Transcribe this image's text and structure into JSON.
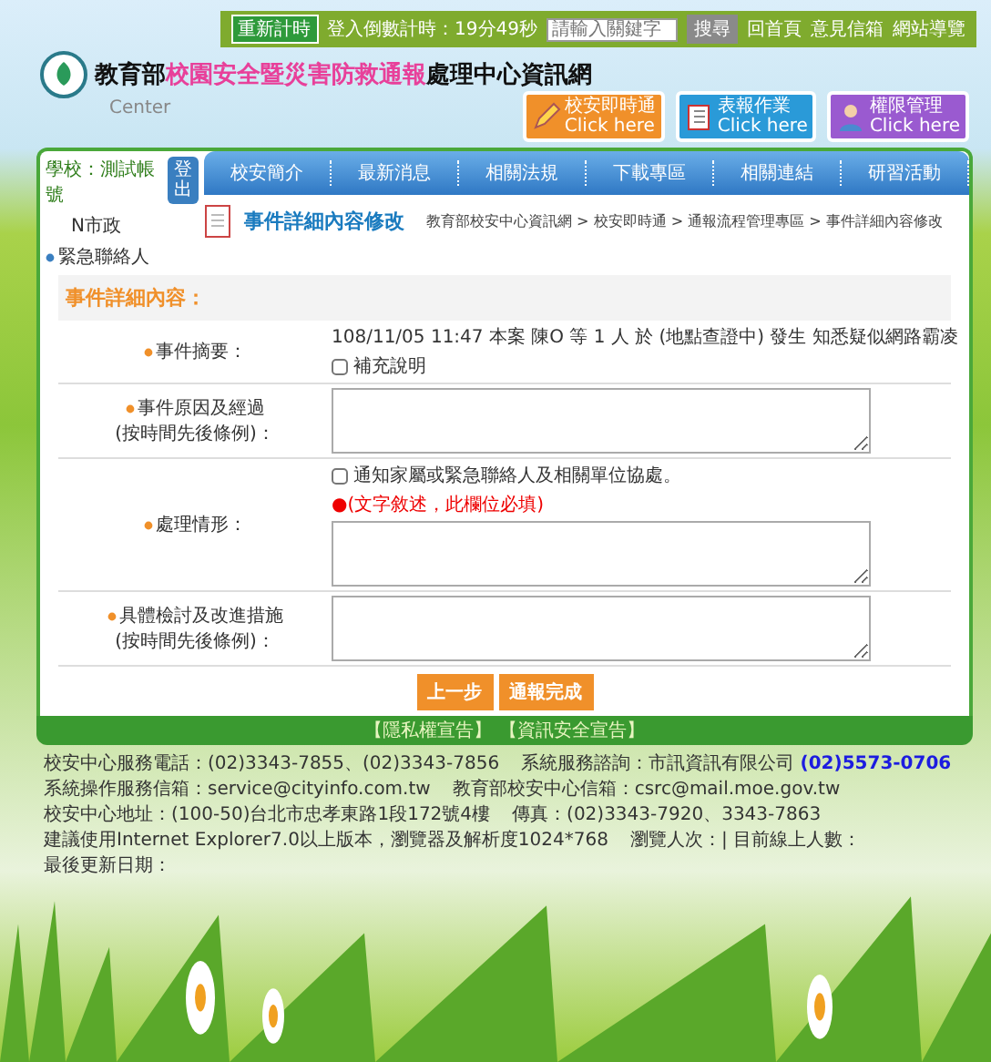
{
  "top_bar": {
    "reset_button": "重新計時",
    "countdown_label": "登入倒數計時：",
    "countdown_value": "19分49秒",
    "search": {
      "placeholder": "請輸入關鍵字"
    },
    "search_button": "搜尋",
    "links": [
      "回首頁",
      "意見信箱",
      "網站導覽"
    ]
  },
  "site_title": {
    "prefix": "教育部",
    "highlight": "校園安全暨災害防救通報",
    "suffix": "處理中心資訊網",
    "subtitle": "Center"
  },
  "shortcuts": [
    {
      "label": "校安即時通",
      "hint": "Click here",
      "kind": "pencil",
      "color": "#f0902a"
    },
    {
      "label": "表報作業",
      "hint": "Click here",
      "kind": "book",
      "color": "#2a9ad8"
    },
    {
      "label": "權限管理",
      "hint": "Click here",
      "kind": "person",
      "color": "#9a5ad0"
    }
  ],
  "sidebar": {
    "school_label": "學校：",
    "school_value": "測試帳號",
    "logout_button": "登出",
    "unit": "N市政",
    "items": [
      "緊急聯絡人"
    ]
  },
  "nav": {
    "items": [
      "校安簡介",
      "最新消息",
      "相關法規",
      "下載專區",
      "相關連結",
      "研習活動"
    ]
  },
  "page_header": {
    "title": "事件詳細內容修改",
    "breadcrumb": "教育部校安中心資訊網 > 校安即時通 > 通報流程管理專區 > 事件詳細內容修改"
  },
  "form": {
    "heading": "事件詳細內容：",
    "rows": [
      {
        "kind": "summary",
        "label": "事件摘要：",
        "text": "108/11/05 11:47 本案 陳O 等 1 人 於 (地點查證中) 發生 知悉疑似網路霸凌",
        "check": {
          "label": "補充說明",
          "checked": false
        }
      },
      {
        "kind": "textarea",
        "label": "事件原因及經過",
        "sub_label": "(按時間先後條例)："
      },
      {
        "kind": "textarea",
        "label": "處理情形：",
        "check": {
          "label": "通知家屬或緊急聯絡人及相關單位協處。",
          "checked": false
        },
        "note": "●(文字敘述，此欄位必填)"
      },
      {
        "kind": "textarea",
        "label": "具體檢討及改進措施",
        "sub_label": "(按時間先後條例)："
      }
    ],
    "buttons": [
      "上一步",
      "通報完成"
    ]
  },
  "footer": {
    "bar_links": [
      "【隱私權宣告】",
      "【資訊安全宣告】"
    ],
    "info": [
      {
        "label": "校安中心服務電話：",
        "value": "(02)3343-7855、(02)3343-7856"
      },
      {
        "label": "系統服務諮詢：",
        "value": "市訊資訊有限公司",
        "link": "(02)5573-0706"
      },
      {
        "label": "系統操作服務信箱：",
        "value": "service@cityinfo.com.tw"
      },
      {
        "label": "教育部校安中心信箱：",
        "value": "csrc@mail.moe.gov.tw"
      },
      {
        "label": "校安中心地址：",
        "value": "(100-50)台北市忠孝東路1段172號4樓"
      },
      {
        "label": "傳真：",
        "value": "(02)3343-7920、3343-7863"
      }
    ],
    "browser_note": "建議使用Internet Explorer7.0以上版本，瀏覽器及解析度1024*768",
    "stats": [
      "瀏覽人次：| 目前線上人數：",
      "最後更新日期："
    ]
  }
}
